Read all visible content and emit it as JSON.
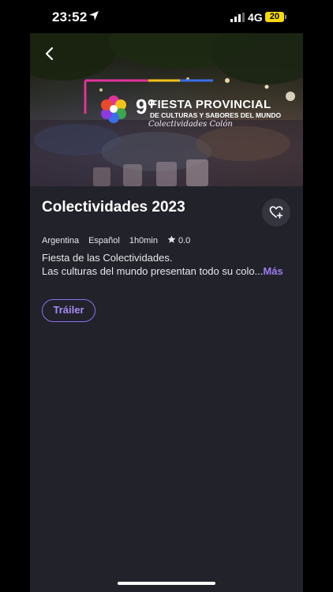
{
  "status_bar": {
    "time": "23:52",
    "network": "4G",
    "battery": "20"
  },
  "hero": {
    "festival_number": "9°",
    "festival_title": "FIESTA PROVINCIAL",
    "festival_subtitle": "DE CULTURAS Y SABORES DEL MUNDO",
    "festival_signature": "Colectividades Colón",
    "colors": {
      "frame_pink": "#e0339a",
      "frame_blue": "#3a6ee8",
      "frame_yellow": "#f0c21a"
    }
  },
  "event": {
    "title": "Colectividades 2023",
    "country": "Argentina",
    "language": "Español",
    "duration": "1h0min",
    "rating": "0.0",
    "description_line1": "Fiesta de las Colectividades.",
    "description_line2": "Las culturas del mundo presentan todo su colo...",
    "more_label": "Más",
    "trailer_label": "Tráiler"
  },
  "icons": [
    "location-arrow-icon",
    "signal-icon",
    "back-chevron-icon",
    "heart-plus-icon",
    "star-icon"
  ],
  "theme": {
    "accent": "#9b7cf0",
    "background": "#22222a"
  }
}
